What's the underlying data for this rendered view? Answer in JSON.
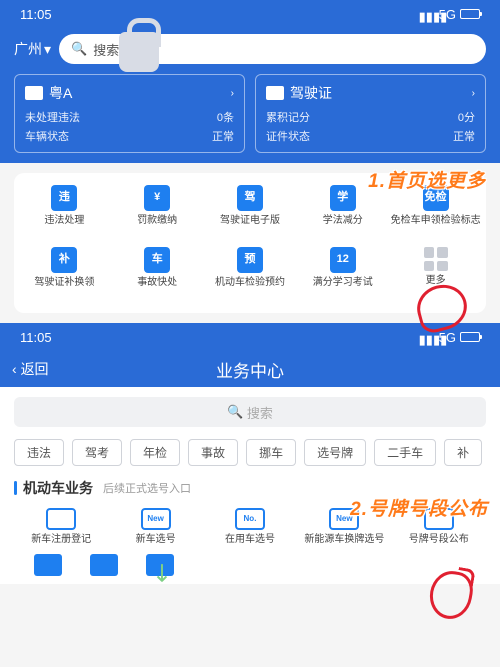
{
  "status": {
    "time": "11:05",
    "net": "5G"
  },
  "s1": {
    "city": "广州",
    "search": "搜索",
    "card1": {
      "title": "粤A",
      "r1l": "未处理违法",
      "r1r": "0条",
      "r2l": "车辆状态",
      "r2r": "正常"
    },
    "card2": {
      "title": "驾驶证",
      "r1l": "累积记分",
      "r1r": "0分",
      "r2l": "证件状态",
      "r2r": "正常"
    },
    "grid": [
      {
        "ic": "违",
        "l": "违法处理"
      },
      {
        "ic": "¥",
        "l": "罚款缴纳"
      },
      {
        "ic": "驾",
        "l": "驾驶证电子版"
      },
      {
        "ic": "学",
        "l": "学法减分"
      },
      {
        "ic": "免检",
        "l": "免检车申领检验标志"
      },
      {
        "ic": "补",
        "l": "驾驶证补换领"
      },
      {
        "ic": "车",
        "l": "事故快处"
      },
      {
        "ic": "预",
        "l": "机动车检验预约"
      },
      {
        "ic": "12",
        "l": "满分学习考试"
      },
      {
        "ic": "",
        "l": "更多"
      }
    ]
  },
  "s2": {
    "back": "返回",
    "title": "业务中心",
    "search": "搜索",
    "tags": [
      "违法",
      "驾考",
      "年检",
      "事故",
      "挪车",
      "选号牌",
      "二手车",
      "补"
    ],
    "secTitle": "机动车业务",
    "hint": "后续正式选号入口",
    "grid": [
      {
        "ic": "",
        "l": "新车注册登记"
      },
      {
        "ic": "New",
        "l": "新车选号"
      },
      {
        "ic": "No.",
        "l": "在用车选号"
      },
      {
        "ic": "New",
        "l": "新能源车换牌选号"
      },
      {
        "ic": "",
        "l": "号牌号段公布"
      }
    ]
  },
  "anno": {
    "a1": "1.首页选更多",
    "a2": "2.号牌号段公布"
  }
}
